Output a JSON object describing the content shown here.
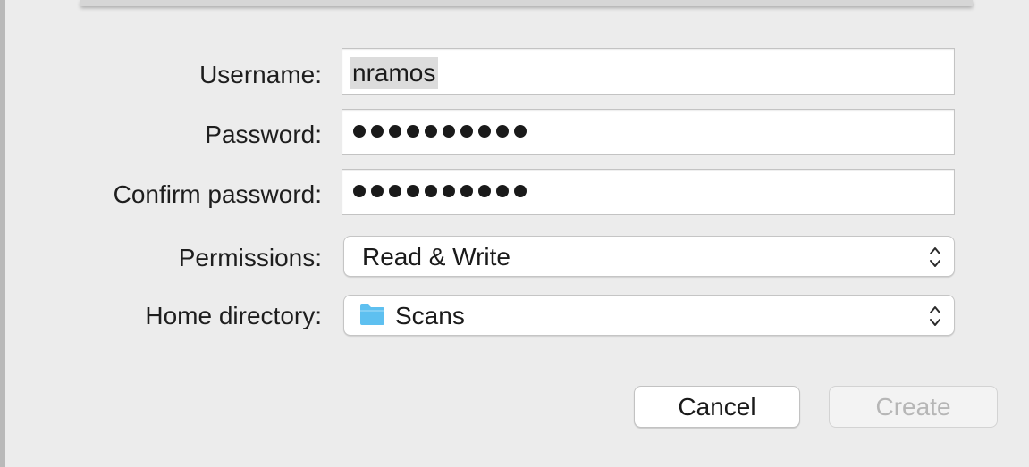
{
  "form": {
    "username_label": "Username:",
    "username_value": "nramos",
    "password_label": "Password:",
    "password_mask": "●●●●●●●●●●",
    "confirm_label": "Confirm password:",
    "confirm_mask": "●●●●●●●●●●",
    "permissions_label": "Permissions:",
    "permissions_value": "Read & Write",
    "home_label": "Home directory:",
    "home_value": "Scans",
    "home_icon": "folder-icon"
  },
  "buttons": {
    "cancel": "Cancel",
    "create": "Create"
  },
  "colors": {
    "folder": "#5ec0f0",
    "disabled_text": "#b6b6b6",
    "background": "#ececec"
  }
}
